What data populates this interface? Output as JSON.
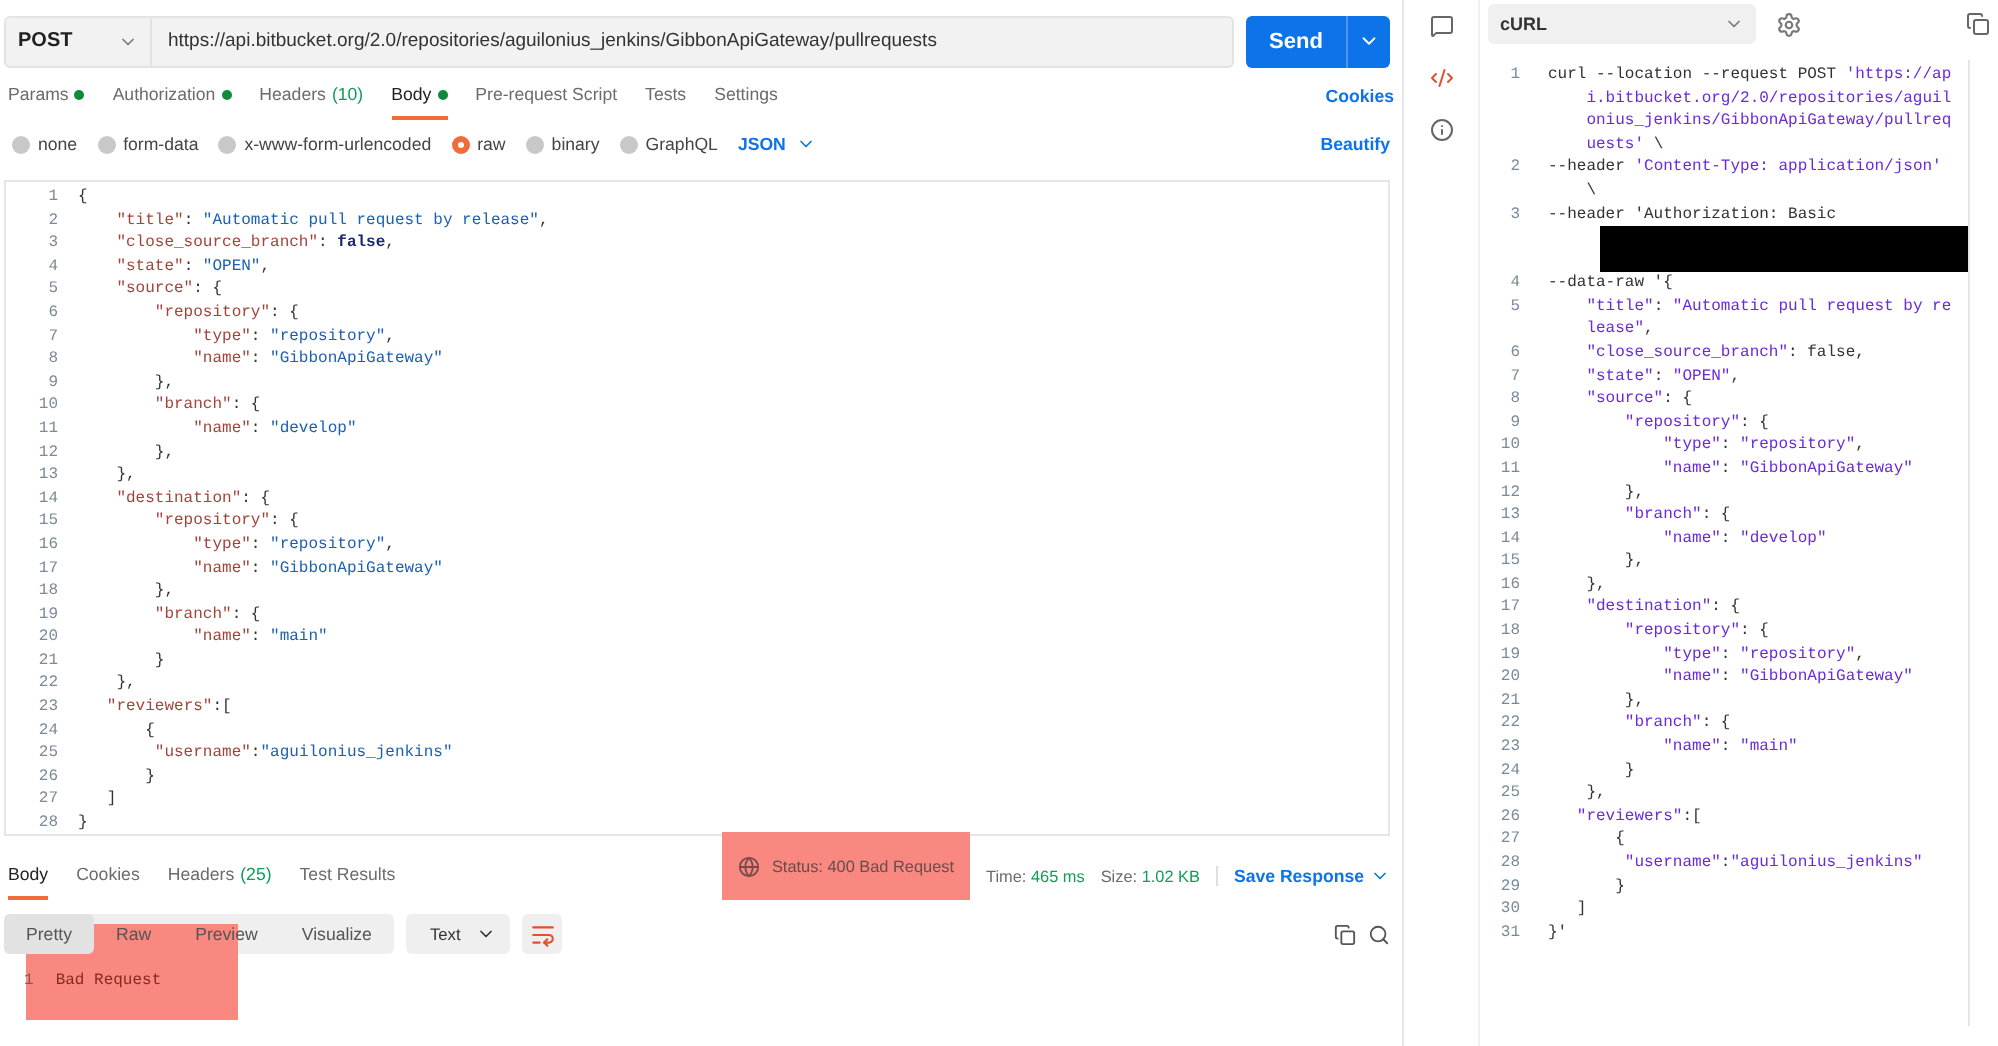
{
  "request": {
    "method": "POST",
    "url": "https://api.bitbucket.org/2.0/repositories/aguilonius_jenkins/GibbonApiGateway/pullrequests",
    "send": "Send"
  },
  "request_tabs": [
    {
      "label": "Params",
      "dot": true,
      "selected": false
    },
    {
      "label": "Authorization",
      "dot": true,
      "selected": false
    },
    {
      "label": "Headers",
      "count": "(10)",
      "dot": false,
      "selected": false
    },
    {
      "label": "Body",
      "dot": true,
      "selected": true
    },
    {
      "label": "Pre-request Script",
      "dot": false,
      "selected": false
    },
    {
      "label": "Tests",
      "dot": false,
      "selected": false
    },
    {
      "label": "Settings",
      "dot": false,
      "selected": false
    }
  ],
  "cookies_link": "Cookies",
  "body_types": [
    {
      "label": "none",
      "selected": false
    },
    {
      "label": "form-data",
      "selected": false
    },
    {
      "label": "x-www-form-urlencoded",
      "selected": false
    },
    {
      "label": "raw",
      "selected": true
    },
    {
      "label": "binary",
      "selected": false
    },
    {
      "label": "GraphQL",
      "selected": false
    }
  ],
  "body_format": "JSON",
  "beautify": "Beautify",
  "editor_lines": [
    {
      "num": "1",
      "text": "{"
    },
    {
      "num": "2",
      "text": "    \"title\": \"Automatic pull request by release\","
    },
    {
      "num": "3",
      "text": "    \"close_source_branch\": false,"
    },
    {
      "num": "4",
      "text": "    \"state\": \"OPEN\","
    },
    {
      "num": "5",
      "text": "    \"source\": {"
    },
    {
      "num": "6",
      "text": "        \"repository\": {"
    },
    {
      "num": "7",
      "text": "            \"type\": \"repository\","
    },
    {
      "num": "8",
      "text": "            \"name\": \"GibbonApiGateway\""
    },
    {
      "num": "9",
      "text": "        },"
    },
    {
      "num": "10",
      "text": "        \"branch\": {"
    },
    {
      "num": "11",
      "text": "            \"name\": \"develop\""
    },
    {
      "num": "12",
      "text": "        },"
    },
    {
      "num": "13",
      "text": "    },"
    },
    {
      "num": "14",
      "text": "    \"destination\": {"
    },
    {
      "num": "15",
      "text": "        \"repository\": {"
    },
    {
      "num": "16",
      "text": "            \"type\": \"repository\","
    },
    {
      "num": "17",
      "text": "            \"name\": \"GibbonApiGateway\""
    },
    {
      "num": "18",
      "text": "        },"
    },
    {
      "num": "19",
      "text": "        \"branch\": {"
    },
    {
      "num": "20",
      "text": "            \"name\": \"main\""
    },
    {
      "num": "21",
      "text": "        }"
    },
    {
      "num": "22",
      "text": "    },"
    },
    {
      "num": "23",
      "text": "   \"reviewers\":["
    },
    {
      "num": "24",
      "text": "       {"
    },
    {
      "num": "25",
      "text": "        \"username\":\"aguilonius_jenkins\""
    },
    {
      "num": "26",
      "text": "       }"
    },
    {
      "num": "27",
      "text": "   ]"
    },
    {
      "num": "28",
      "text": "}"
    }
  ],
  "response_tabs": [
    {
      "label": "Body",
      "selected": true
    },
    {
      "label": "Cookies",
      "selected": false
    },
    {
      "label": "Headers",
      "count": "(25)",
      "selected": false
    },
    {
      "label": "Test Results",
      "selected": false
    }
  ],
  "status": {
    "label": "Status:",
    "value": "400 Bad Request"
  },
  "time": {
    "label": "Time:",
    "value": "465 ms"
  },
  "size": {
    "label": "Size:",
    "value": "1.02 KB"
  },
  "save_response": "Save Response",
  "view_modes": [
    {
      "label": "Pretty",
      "selected": true
    },
    {
      "label": "Raw",
      "selected": false
    },
    {
      "label": "Preview",
      "selected": false
    },
    {
      "label": "Visualize",
      "selected": false
    }
  ],
  "response_format": "Text",
  "response_lines": [
    {
      "num": "1",
      "text": "Bad Request"
    }
  ],
  "snippet": {
    "language": "cURL",
    "lines": [
      {
        "kind": "code",
        "num": "1",
        "text": "curl --location --request POST 'https://api.bitbucket.org/2.0/repositories/aguilonius_jenkins/GibbonApiGateway/pullrequests' \\"
      },
      {
        "kind": "code",
        "num": "2",
        "text": "--header 'Content-Type: application/json' \\"
      },
      {
        "kind": "code",
        "num": "3",
        "text": "--header 'Authorization: Basic"
      },
      {
        "kind": "redaction"
      },
      {
        "kind": "code",
        "num": "4",
        "text": "--data-raw '{"
      },
      {
        "kind": "code",
        "num": "5",
        "text": "    \"title\": \"Automatic pull request by release\","
      },
      {
        "kind": "code",
        "num": "6",
        "text": "    \"close_source_branch\": false,"
      },
      {
        "kind": "code",
        "num": "7",
        "text": "    \"state\": \"OPEN\","
      },
      {
        "kind": "code",
        "num": "8",
        "text": "    \"source\": {"
      },
      {
        "kind": "code",
        "num": "9",
        "text": "        \"repository\": {"
      },
      {
        "kind": "code",
        "num": "10",
        "text": "            \"type\": \"repository\","
      },
      {
        "kind": "code",
        "num": "11",
        "text": "            \"name\": \"GibbonApiGateway\""
      },
      {
        "kind": "code",
        "num": "12",
        "text": "        },"
      },
      {
        "kind": "code",
        "num": "13",
        "text": "        \"branch\": {"
      },
      {
        "kind": "code",
        "num": "14",
        "text": "            \"name\": \"develop\""
      },
      {
        "kind": "code",
        "num": "15",
        "text": "        },"
      },
      {
        "kind": "code",
        "num": "16",
        "text": "    },"
      },
      {
        "kind": "code",
        "num": "17",
        "text": "    \"destination\": {"
      },
      {
        "kind": "code",
        "num": "18",
        "text": "        \"repository\": {"
      },
      {
        "kind": "code",
        "num": "19",
        "text": "            \"type\": \"repository\","
      },
      {
        "kind": "code",
        "num": "20",
        "text": "            \"name\": \"GibbonApiGateway\""
      },
      {
        "kind": "code",
        "num": "21",
        "text": "        },"
      },
      {
        "kind": "code",
        "num": "22",
        "text": "        \"branch\": {"
      },
      {
        "kind": "code",
        "num": "23",
        "text": "            \"name\": \"main\""
      },
      {
        "kind": "code",
        "num": "24",
        "text": "        }"
      },
      {
        "kind": "code",
        "num": "25",
        "text": "    },"
      },
      {
        "kind": "code",
        "num": "26",
        "text": "   \"reviewers\":["
      },
      {
        "kind": "code",
        "num": "27",
        "text": "       {"
      },
      {
        "kind": "code",
        "num": "28",
        "text": "        \"username\":\"aguilonius_jenkins\""
      },
      {
        "kind": "code",
        "num": "29",
        "text": "       }"
      },
      {
        "kind": "code",
        "num": "30",
        "text": "   ]"
      },
      {
        "kind": "code",
        "num": "31",
        "text": "}'"
      }
    ]
  }
}
